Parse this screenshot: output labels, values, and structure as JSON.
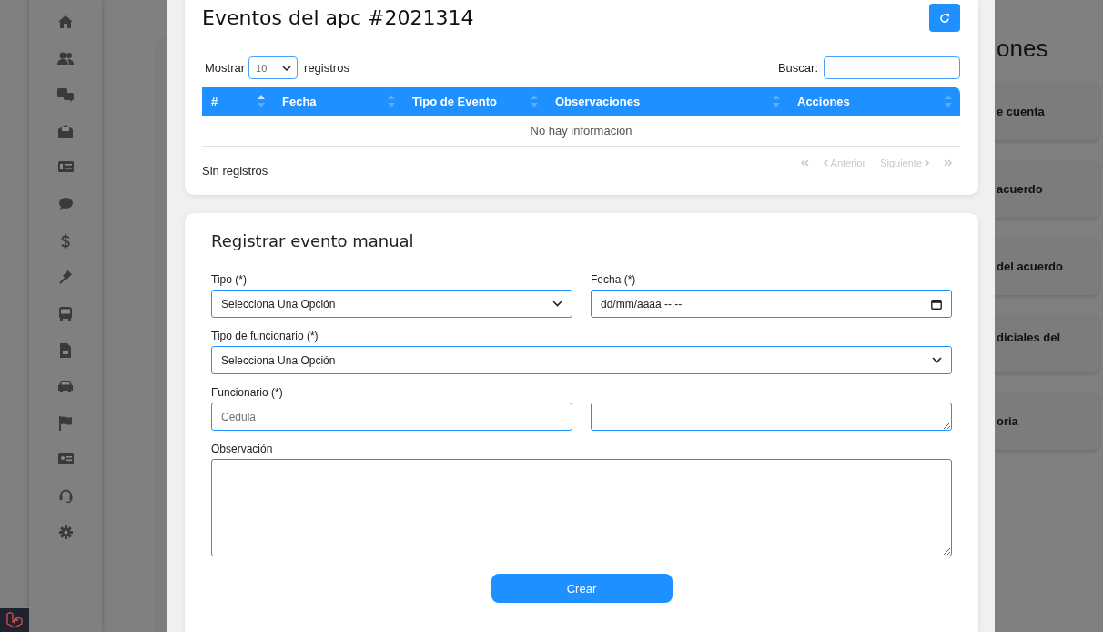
{
  "background": {
    "heading": "ones",
    "cards": [
      "e cuenta",
      "acuerdo",
      "del acuerdo",
      "diciales del",
      "oria"
    ]
  },
  "modal": {
    "title": "Eventos del apc #2021314",
    "length_before": "Mostrar",
    "length_value": "10",
    "length_after": "registros",
    "search_label": "Buscar:",
    "columns": [
      {
        "label": "#",
        "sorted": true
      },
      {
        "label": "Fecha",
        "sorted": false
      },
      {
        "label": "Tipo de Evento",
        "sorted": false
      },
      {
        "label": "Observaciones",
        "sorted": false
      },
      {
        "label": "Acciones",
        "sorted": false
      }
    ],
    "empty_message": "No hay información",
    "info": "Sin registros",
    "pagination": [
      {
        "kind": "first",
        "disabled": true
      },
      {
        "kind": "prev",
        "label": "Anterior",
        "disabled": true
      },
      {
        "kind": "next",
        "label": "Siguiente",
        "disabled": true
      },
      {
        "kind": "last",
        "disabled": true
      }
    ]
  },
  "form": {
    "title": "Registrar evento manual",
    "fields": [
      {
        "kind": "select",
        "label": "Tipo (*)",
        "value": "Selecciona Una Opción",
        "wide": false
      },
      {
        "kind": "datetime",
        "label": "Fecha (*)",
        "value": "dd/mm/aaaa --:--",
        "wide": false
      },
      {
        "kind": "select",
        "label": "Tipo de funcionario (*)",
        "value": "Selecciona Una Opción",
        "wide": true
      },
      {
        "kind": "text",
        "label": "Funcionario (*)",
        "placeholder": "Cedula",
        "wide": false
      },
      {
        "kind": "textarea",
        "wide": false
      },
      {
        "kind": "textarea",
        "label": "Observación",
        "wide": true
      }
    ],
    "submit": "Crear"
  }
}
